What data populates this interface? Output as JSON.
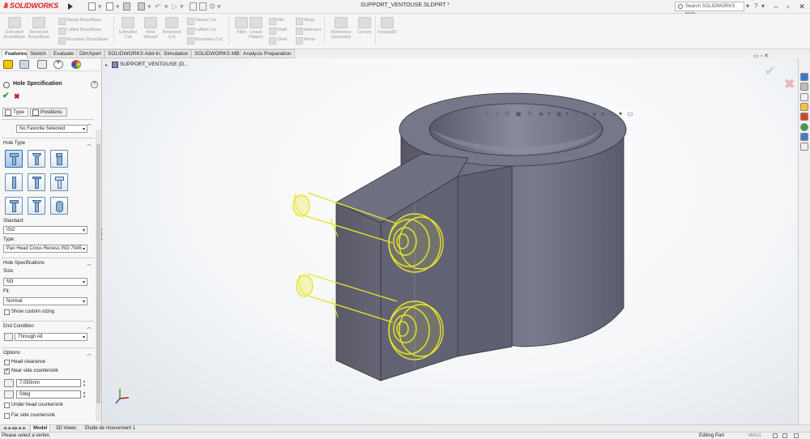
{
  "app": {
    "logo": "SOLIDWORKS",
    "document_title": "SUPPORT_VENTOUSE.SLDPRT *",
    "search_placeholder": "Search SOLIDWORKS Help"
  },
  "ribbon": {
    "big_buttons": [
      {
        "label": "Extruded Boss/Base",
        "icon": "extrude-icon"
      },
      {
        "label": "Revolved Boss/Base",
        "icon": "revolve-icon"
      },
      {
        "label": "Extruded Cut",
        "icon": "extruded-cut-icon"
      },
      {
        "label": "Hole Wizard",
        "icon": "hole-wizard-icon"
      },
      {
        "label": "Revolved Cut",
        "icon": "revolved-cut-icon"
      },
      {
        "label": "Fillet",
        "icon": "fillet-icon"
      },
      {
        "label": "Linear Pattern",
        "icon": "linear-pattern-icon"
      },
      {
        "label": "Reference Geometry",
        "icon": "reference-geometry-icon"
      },
      {
        "label": "Curves",
        "icon": "curves-icon"
      },
      {
        "label": "Instant3D",
        "icon": "instant3d-icon"
      }
    ],
    "small_buttons": [
      {
        "label": "Swept Boss/Base"
      },
      {
        "label": "Lofted Boss/Base"
      },
      {
        "label": "Boundary Boss/Base"
      },
      {
        "label": "Swept Cut"
      },
      {
        "label": "Lofted Cut"
      },
      {
        "label": "Boundary Cut"
      },
      {
        "label": "Rib"
      },
      {
        "label": "Draft"
      },
      {
        "label": "Shell"
      },
      {
        "label": "Wrap"
      },
      {
        "label": "Intersect"
      },
      {
        "label": "Mirror"
      }
    ]
  },
  "tabs": [
    "Features",
    "Sketch",
    "Evaluate",
    "DimXpert",
    "SOLIDWORKS Add-Ins",
    "Simulation",
    "SOLIDWORKS MBD",
    "Analysis Preparation"
  ],
  "panel": {
    "title": "Hole Specification",
    "help": "?",
    "ok": "✔",
    "cancel": "✖",
    "subtabs": [
      "Type",
      "Positions"
    ],
    "favorite": "No Favorite Selected",
    "hole_type_label": "Hole Type",
    "standard_label": "Standard:",
    "standard_value": "ISO",
    "type_label": "Type:",
    "type_value": "Pan Head Cross Recess ISO 7045",
    "hole_specs_label": "Hole Specifications",
    "size_label": "Size:",
    "size_value": "M3",
    "fit_label": "Fit:",
    "fit_value": "Normal",
    "show_custom_sizing": "Show custom sizing",
    "end_condition_label": "End Condition",
    "end_condition_value": "Through All",
    "options_label": "Options",
    "head_clearance": "Head clearance",
    "near_side_countersink": "Near side countersink",
    "countersink_diameter": "7.050mm",
    "countersink_angle": "0deg",
    "under_head_countersink": "Under head countersink",
    "far_side_countersink": "Far side countersink"
  },
  "tree": {
    "root": "SUPPORT_VENTOUSE (D..."
  },
  "bottom_tabs": [
    "Model",
    "3D Views",
    "Etude de mouvement 1"
  ],
  "status": {
    "message": "Please select a vertex.",
    "mode": "Editing Part",
    "units": "MMGS"
  },
  "colors": {
    "accent": "#d22222",
    "model_body": "#6c6c80",
    "selection_highlight": "#e6e62a",
    "ok_green": "#2a9a2a",
    "cancel_red": "#c01818"
  }
}
